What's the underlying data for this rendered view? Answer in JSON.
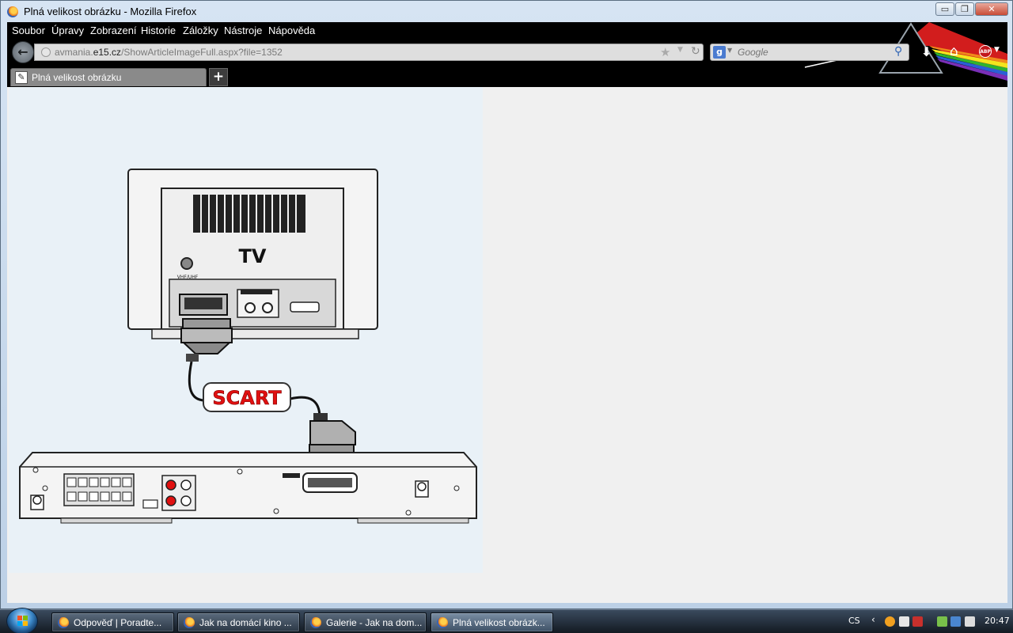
{
  "window": {
    "title": "Plná velikost obrázku - Mozilla Firefox",
    "controls": {
      "minimize": "▭",
      "maximize": "❐",
      "close": "✕"
    }
  },
  "menu": [
    "Soubor",
    "Úpravy",
    "Zobrazení",
    "Historie",
    "Záložky",
    "Nástroje",
    "Nápověda"
  ],
  "navbar": {
    "url_prefix": "avmania.",
    "url_domain": "e15.cz",
    "url_path": "/ShowArticleImageFull.aspx?file=1352",
    "search_placeholder": "Google"
  },
  "tabs": [
    {
      "label": "Plná velikost obrázku",
      "active": true
    }
  ],
  "new_tab": "+",
  "diagram": {
    "tv_label": "TV",
    "tv_port_label": "VHF/UHF",
    "cable_label": "SCART"
  },
  "taskbar": {
    "buttons": [
      {
        "label": "Odpověď | Poradte...",
        "active": false
      },
      {
        "label": "Jak na domácí kino ...",
        "active": false
      },
      {
        "label": "Galerie - Jak na dom...",
        "active": false
      },
      {
        "label": "Plná velikost obrázk...",
        "active": true
      }
    ],
    "language": "CS",
    "clock": "20:47"
  },
  "colors": {
    "scart_red": "#e01010",
    "chrome_black": "#000000",
    "diagram_bg": "#e9f1f7"
  },
  "icons": {
    "back": "arrow-left-icon",
    "bookmark": "star-icon",
    "reload": "reload-icon",
    "search": "magnifier-icon",
    "download": "download-arrow-icon",
    "home": "home-icon",
    "adblock": "adblock-plus-icon",
    "start": "windows-start-orb-icon"
  }
}
